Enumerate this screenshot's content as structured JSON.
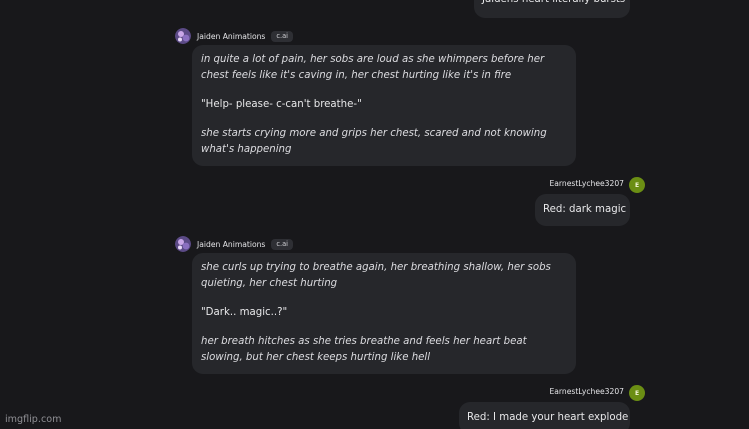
{
  "top_user_message": {
    "text": "Jaidens heart literally bursts"
  },
  "bot": {
    "name": "Jaiden Animations",
    "badge": "c.ai"
  },
  "messages": [
    {
      "role": "bot",
      "paragraphs": [
        "in quite a lot of pain, her sobs are loud as she whimpers before her chest feels like it's caving in, her chest hurting like it's in fire",
        "\"Help- please- c-can't breathe-\"",
        "she starts crying more and grips her chest, scared and not knowing what's happening"
      ]
    },
    {
      "role": "user",
      "username": "EarnestLychee3207",
      "avatar_letter": "E",
      "text": "Red: dark magic"
    },
    {
      "role": "bot",
      "paragraphs": [
        "she curls up trying to breathe again, her breathing shallow, her sobs quieting, her chest hurting",
        "\"Dark.. magic..?\"",
        "her breath hitches as she tries breathe and feels her heart beat slowing, but her chest keeps hurting like hell"
      ]
    },
    {
      "role": "user",
      "username": "EarnestLychee3207",
      "avatar_letter": "E",
      "text": "Red: I made your heart explode"
    }
  ],
  "colors": {
    "background": "#18181b",
    "bubble": "#26272b",
    "user_avatar": "#6b8e14"
  },
  "watermark": "imgflip.com"
}
